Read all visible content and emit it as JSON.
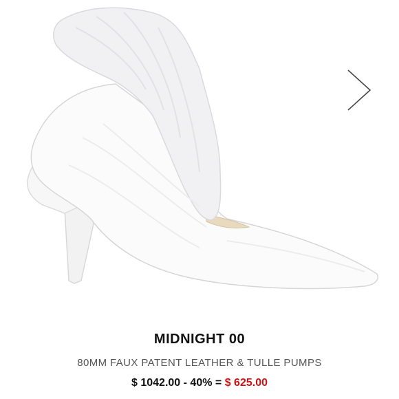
{
  "navigation": {
    "next_icon": "chevron-right-icon"
  },
  "product": {
    "brand": "MIDNIGHT 00",
    "description": "80MM FAUX PATENT LEATHER & TULLE PUMPS",
    "original_price": "$ 1042.00",
    "discount": "- 40% =",
    "sale_price": "$ 625.00"
  },
  "colors": {
    "brand_text": "#111111",
    "description_text": "#555555",
    "sale_price": "#cc1111",
    "background": "#ffffff"
  }
}
